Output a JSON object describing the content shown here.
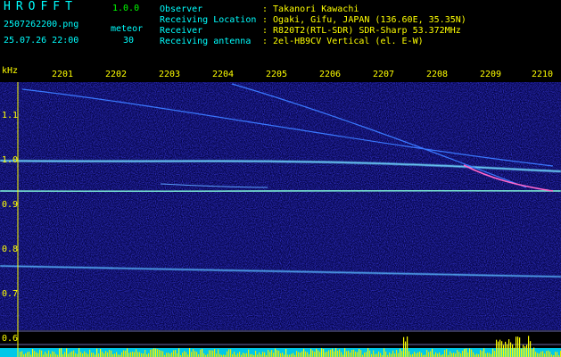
{
  "header": {
    "app_title": "HROFFT",
    "version": "1.0.0",
    "filename": "2507262200.png",
    "datetime": "25.07.26 22:00",
    "meteor_label": "meteor",
    "meteor_count": "30",
    "fields": [
      {
        "label": "Observer",
        "value": ": Takanori Kawachi"
      },
      {
        "label": "Receiving Location",
        "value": ": Ogaki, Gifu, JAPAN (136.60E, 35.35N)"
      },
      {
        "label": "Receiver",
        "value": ": R820T2(RTL-SDR) SDR-Sharp 53.372MHz"
      },
      {
        "label": "Receiving antenna",
        "value": ": 2el-HB9CV Vertical (el. E-W)"
      }
    ]
  },
  "axis": {
    "unit": "kHz",
    "x_ticks": [
      "2201",
      "2202",
      "2203",
      "2204",
      "2205",
      "2206",
      "2207",
      "2208",
      "2209",
      "2210"
    ],
    "y_ticks": [
      "1.1",
      "1.0",
      "0.9",
      "0.8",
      "0.7",
      "0.6"
    ]
  },
  "colors": {
    "background": "#000000",
    "label": "#00ffff",
    "value": "#ffff00",
    "spectrogram": "#0a0a6e"
  }
}
